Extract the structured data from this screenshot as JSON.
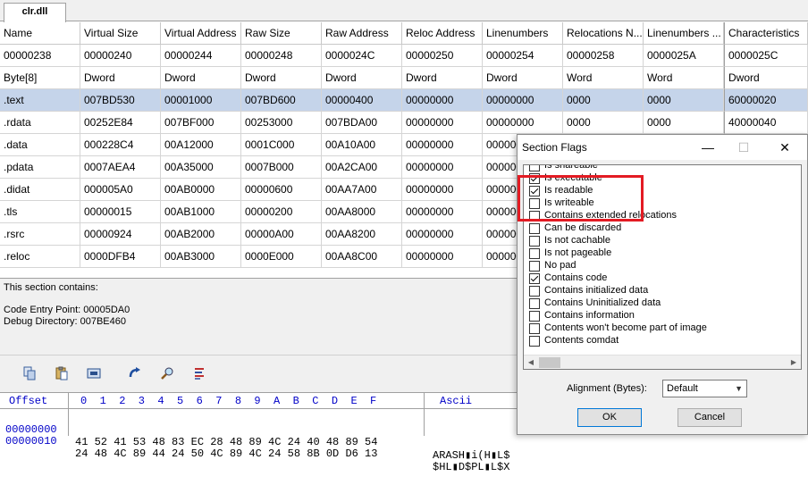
{
  "tab": {
    "label": "clr.dll"
  },
  "grid": {
    "columns": [
      "Name",
      "Virtual Size",
      "Virtual Address",
      "Raw Size",
      "Raw Address",
      "Reloc Address",
      "Linenumbers",
      "Relocations N...",
      "Linenumbers ...",
      "Characteristics"
    ],
    "offsets": [
      "00000238",
      "00000240",
      "00000244",
      "00000248",
      "0000024C",
      "00000250",
      "00000254",
      "00000258",
      "0000025A",
      "0000025C"
    ],
    "types": [
      "Byte[8]",
      "Dword",
      "Dword",
      "Dword",
      "Dword",
      "Dword",
      "Dword",
      "Word",
      "Word",
      "Dword"
    ],
    "rows": [
      [
        ".text",
        "007BD530",
        "00001000",
        "007BD600",
        "00000400",
        "00000000",
        "00000000",
        "0000",
        "0000",
        "60000020"
      ],
      [
        ".rdata",
        "00252E84",
        "007BF000",
        "00253000",
        "007BDA00",
        "00000000",
        "00000000",
        "0000",
        "0000",
        "40000040"
      ],
      [
        ".data",
        "000228C4",
        "00A12000",
        "0001C000",
        "00A10A00",
        "00000000",
        "000000",
        "",
        "",
        ""
      ],
      [
        ".pdata",
        "0007AEA4",
        "00A35000",
        "0007B000",
        "00A2CA00",
        "00000000",
        "000000",
        "",
        "",
        ""
      ],
      [
        ".didat",
        "000005A0",
        "00AB0000",
        "00000600",
        "00AA7A00",
        "00000000",
        "000000",
        "",
        "",
        ""
      ],
      [
        ".tls",
        "00000015",
        "00AB1000",
        "00000200",
        "00AA8000",
        "00000000",
        "000000",
        "",
        "",
        ""
      ],
      [
        ".rsrc",
        "00000924",
        "00AB2000",
        "00000A00",
        "00AA8200",
        "00000000",
        "000000",
        "",
        "",
        ""
      ],
      [
        ".reloc",
        "0000DFB4",
        "00AB3000",
        "0000E000",
        "00AA8C00",
        "00000000",
        "000000",
        "",
        "",
        ""
      ]
    ]
  },
  "info": {
    "heading": "This section contains:",
    "line1": "Code Entry Point: 00005DA0",
    "line2": "Debug Directory: 007BE460"
  },
  "hex": {
    "header_offset": "Offset",
    "header_bytes": "0  1  2  3  4  5  6  7  8  9  A  B  C  D  E  F",
    "header_ascii": "Ascii",
    "lines": [
      {
        "offset": "00000000",
        "bytes": "41 52 41 53 48 83 EC 28 48 89 4C 24 40 48 89 54",
        "ascii": "ARASH▮i(H▮L$"
      },
      {
        "offset": "00000010",
        "bytes": "24 48 4C 89 44 24 50 4C 89 4C 24 58 8B 0D D6 13",
        "ascii": "$HL▮D$PL▮L$X"
      }
    ]
  },
  "dialog": {
    "title": "Section Flags",
    "min_glyph": "—",
    "max_glyph": "☐",
    "close_glyph": "✕",
    "flags": [
      {
        "label": "Is shareable",
        "checked": false
      },
      {
        "label": "Is executable",
        "checked": true
      },
      {
        "label": "Is readable",
        "checked": true
      },
      {
        "label": "Is writeable",
        "checked": false
      },
      {
        "label": "Contains extended relocations",
        "checked": false
      },
      {
        "label": "Can be discarded",
        "checked": false
      },
      {
        "label": "Is not cachable",
        "checked": false
      },
      {
        "label": "Is not pageable",
        "checked": false
      },
      {
        "label": "No pad",
        "checked": false
      },
      {
        "label": "Contains code",
        "checked": true
      },
      {
        "label": "Contains initialized data",
        "checked": false
      },
      {
        "label": "Contains Uninitialized data",
        "checked": false
      },
      {
        "label": "Contains information",
        "checked": false
      },
      {
        "label": "Contents won't become part of image",
        "checked": false
      },
      {
        "label": "Contents comdat",
        "checked": false
      }
    ],
    "alignment_label": "Alignment (Bytes):",
    "alignment_value": "Default",
    "ok_label": "OK",
    "cancel_label": "Cancel",
    "highlight_color": "#e31b23"
  }
}
